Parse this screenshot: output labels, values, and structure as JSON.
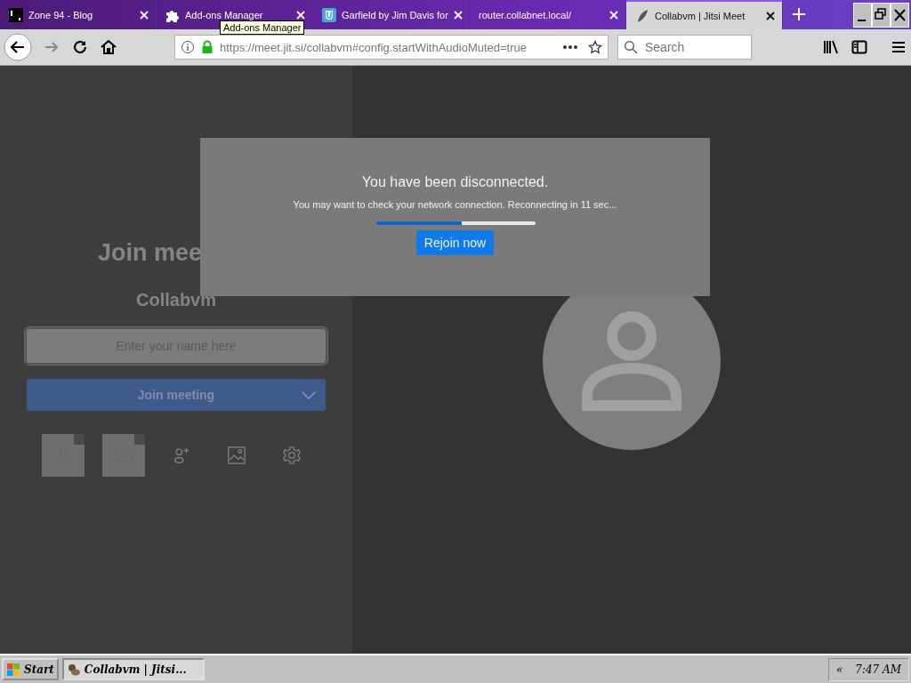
{
  "browser": {
    "tabs": [
      {
        "title": "Zone 94 - Blog",
        "selected": false
      },
      {
        "title": "Add-ons Manager",
        "selected": false
      },
      {
        "title": "Garfield by Jim Davis for",
        "selected": false
      },
      {
        "title": "router.collabnet.local/",
        "selected": false
      },
      {
        "title": "Collabvm | Jitsi Meet",
        "selected": true
      }
    ],
    "tooltip": "Add-ons Manager",
    "url": "https://meet.jit.si/collabvm#config.startWithAudioMuted=true",
    "search": {
      "placeholder": "Search"
    }
  },
  "prejoin": {
    "title": "Join mee",
    "room": "Collabvm",
    "name_field": {
      "placeholder": "Enter your name here"
    },
    "join_button": "Join meeting",
    "controls": [
      {
        "kind": "mic"
      },
      {
        "kind": "camera"
      },
      {
        "kind": "invite"
      },
      {
        "kind": "background"
      },
      {
        "kind": "settings"
      }
    ]
  },
  "dialog": {
    "title": "You have been disconnected.",
    "message": "You may want to check your network connection. Reconnecting in 11 sec...",
    "level": 0.54,
    "button": "Rejoin now"
  },
  "taskbar": {
    "start": "Start",
    "task": "Collabvm | Jitsi...",
    "tray_toggle": "«",
    "clock": "7:47 AM"
  }
}
